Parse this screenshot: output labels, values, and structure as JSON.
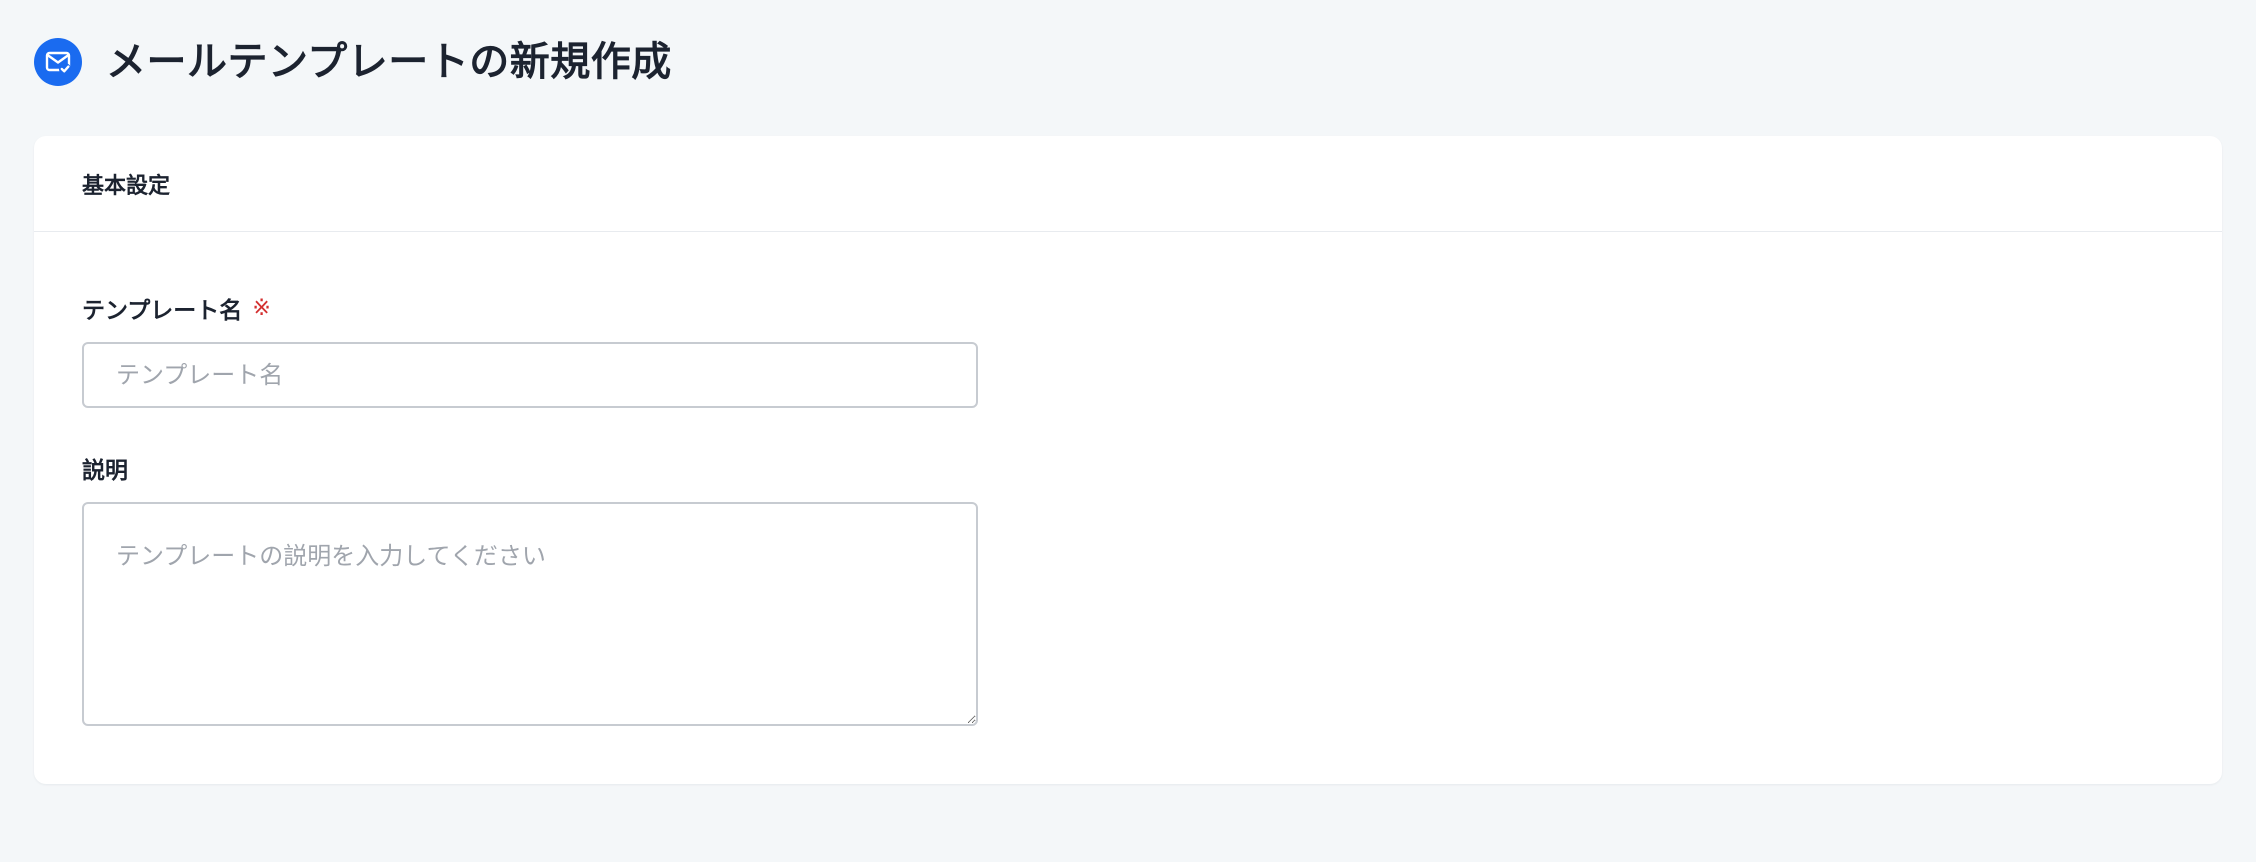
{
  "header": {
    "title": "メールテンプレートの新規作成",
    "icon": "mail-check-icon",
    "accent_color": "#1a6bf0"
  },
  "card": {
    "title": "基本設定"
  },
  "form": {
    "template_name": {
      "label": "テンプレート名",
      "required_mark": "※",
      "placeholder": "テンプレート名",
      "value": ""
    },
    "description": {
      "label": "説明",
      "placeholder": "テンプレートの説明を入力してください",
      "value": ""
    }
  },
  "colors": {
    "background": "#f4f7f9",
    "card_background": "#ffffff",
    "required": "#d32f2f",
    "border": "#c7cbd1"
  }
}
